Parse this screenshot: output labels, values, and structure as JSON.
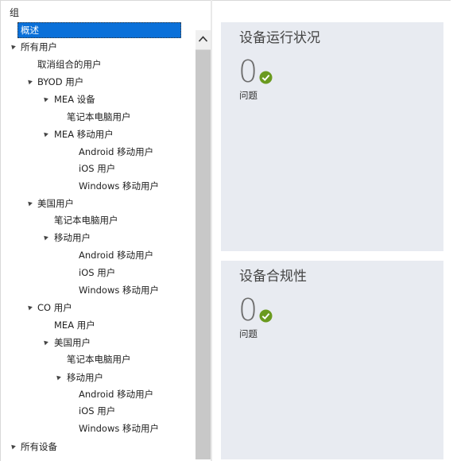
{
  "tree": {
    "header": "组",
    "items": [
      {
        "label": "概述",
        "expander": false,
        "selected": true
      },
      {
        "label": "所有用户",
        "expander": true
      },
      {
        "label": "取消组合的用户",
        "expander": false
      },
      {
        "label": "BYOD 用户",
        "expander": true
      },
      {
        "label": "MEA 设备",
        "expander": true
      },
      {
        "label": "笔记本电脑用户",
        "expander": false
      },
      {
        "label": "MEA 移动用户",
        "expander": true
      },
      {
        "label": "Android 移动用户",
        "expander": false
      },
      {
        "label": "iOS 用户",
        "expander": false
      },
      {
        "label": "Windows 移动用户",
        "expander": false
      },
      {
        "label": "美国用户",
        "expander": true
      },
      {
        "label": "笔记本电脑用户",
        "expander": false
      },
      {
        "label": "移动用户",
        "expander": true
      },
      {
        "label": "Android 移动用户",
        "expander": false
      },
      {
        "label": "iOS 用户",
        "expander": false
      },
      {
        "label": "Windows 移动用户",
        "expander": false
      },
      {
        "label": "CO 用户",
        "expander": true
      },
      {
        "label": "MEA 用户",
        "expander": false
      },
      {
        "label": "美国用户",
        "expander": true
      },
      {
        "label": "笔记本电脑用户",
        "expander": false
      },
      {
        "label": "移动用户",
        "expander": true
      },
      {
        "label": "Android 移动用户",
        "expander": false
      },
      {
        "label": "iOS 用户",
        "expander": false
      },
      {
        "label": "Windows 移动用户",
        "expander": false
      },
      {
        "label": "所有设备",
        "expander": true
      }
    ]
  },
  "tiles": {
    "health": {
      "title": "设备运行状况",
      "value": "0",
      "caption": "问题"
    },
    "compliance": {
      "title": "设备合规性",
      "value": "0",
      "caption": "问题"
    }
  },
  "icons": {
    "expander": "expanded-triangle-icon",
    "scroll_up": "chevron-up-icon",
    "status_ok": "checkmark-circle-icon"
  },
  "colors": {
    "selection": "#0a70d9",
    "tile_background": "#e8ebf1",
    "status_ok": "#6a9a1f"
  }
}
